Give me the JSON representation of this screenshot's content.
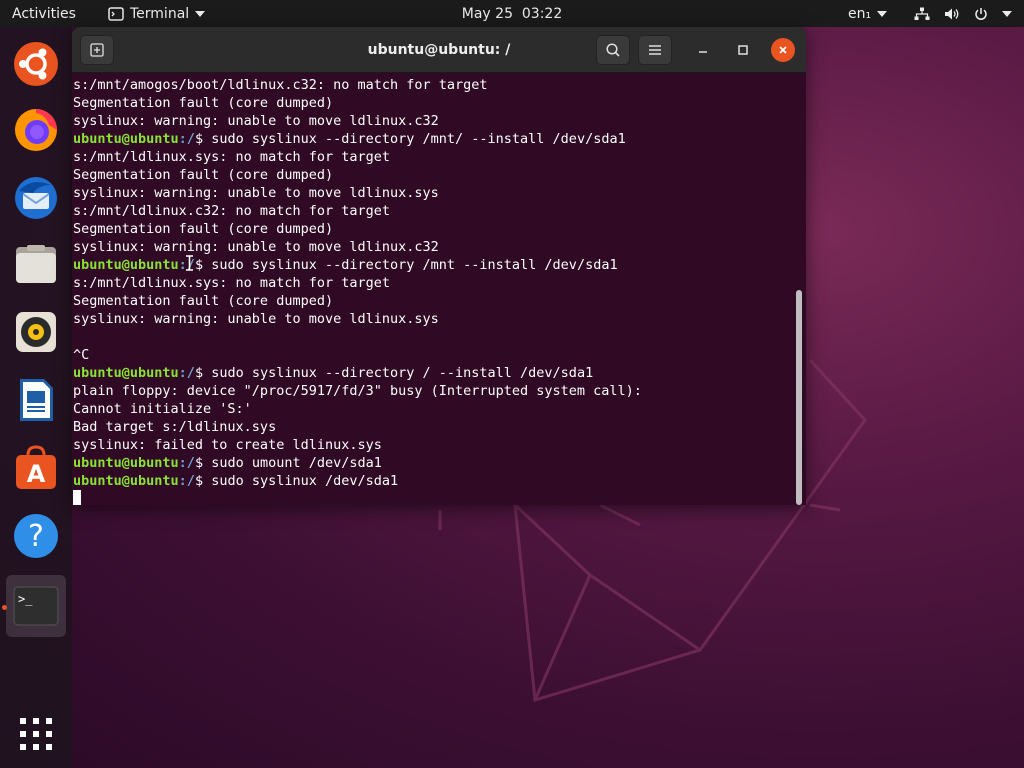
{
  "topbar": {
    "activities": "Activities",
    "app_name": "Terminal",
    "clock": "May 25  03:22",
    "language": "en₁"
  },
  "dock": {
    "items": [
      {
        "name": "Ubuntu installer",
        "icon": "ubuntu-installer-icon"
      },
      {
        "name": "Firefox",
        "icon": "firefox-icon"
      },
      {
        "name": "Thunderbird",
        "icon": "thunderbird-icon"
      },
      {
        "name": "Files",
        "icon": "files-icon"
      },
      {
        "name": "Rhythmbox",
        "icon": "rhythmbox-icon"
      },
      {
        "name": "LibreOffice Writer",
        "icon": "libreoffice-writer-icon"
      },
      {
        "name": "Ubuntu Software",
        "icon": "ubuntu-software-icon"
      },
      {
        "name": "Help",
        "icon": "help-icon"
      },
      {
        "name": "Terminal",
        "icon": "terminal-icon"
      },
      {
        "name": "Show Applications",
        "icon": "app-grid-icon"
      }
    ]
  },
  "window": {
    "title": "ubuntu@ubuntu: /"
  },
  "terminal": {
    "prompt_user": "ubuntu@ubuntu",
    "lines": [
      {
        "type": "out",
        "text": "s:/mnt/amogos/boot/ldlinux.c32: no match for target"
      },
      {
        "type": "out",
        "text": "Segmentation fault (core dumped)"
      },
      {
        "type": "out",
        "text": "syslinux: warning: unable to move ldlinux.c32"
      },
      {
        "type": "cmd",
        "user": "ubuntu@ubuntu",
        "path": ":/",
        "text": "$ sudo syslinux --directory /mnt/ --install /dev/sda1"
      },
      {
        "type": "out",
        "text": "s:/mnt/ldlinux.sys: no match for target"
      },
      {
        "type": "out",
        "text": "Segmentation fault (core dumped)"
      },
      {
        "type": "out",
        "text": "syslinux: warning: unable to move ldlinux.sys"
      },
      {
        "type": "out",
        "text": "s:/mnt/ldlinux.c32: no match for target"
      },
      {
        "type": "out",
        "text": "Segmentation fault (core dumped)"
      },
      {
        "type": "out",
        "text": "syslinux: warning: unable to move ldlinux.c32"
      },
      {
        "type": "cmd",
        "user": "ubuntu@ubuntu",
        "path": ":/",
        "text": "$ sudo syslinux --directory /mnt --install /dev/sda1"
      },
      {
        "type": "out",
        "text": "s:/mnt/ldlinux.sys: no match for target"
      },
      {
        "type": "out",
        "text": "Segmentation fault (core dumped)"
      },
      {
        "type": "out",
        "text": "syslinux: warning: unable to move ldlinux.sys"
      },
      {
        "type": "out",
        "text": ""
      },
      {
        "type": "out",
        "text": "^C"
      },
      {
        "type": "cmd",
        "user": "ubuntu@ubuntu",
        "path": ":/",
        "text": "$ sudo syslinux --directory / --install /dev/sda1"
      },
      {
        "type": "out",
        "text": "plain floppy: device \"/proc/5917/fd/3\" busy (Interrupted system call):"
      },
      {
        "type": "out",
        "text": "Cannot initialize 'S:'"
      },
      {
        "type": "out",
        "text": "Bad target s:/ldlinux.sys"
      },
      {
        "type": "out",
        "text": "syslinux: failed to create ldlinux.sys"
      },
      {
        "type": "cmd",
        "user": "ubuntu@ubuntu",
        "path": ":/",
        "text": "$ sudo umount /dev/sda1"
      },
      {
        "type": "cmd",
        "user": "ubuntu@ubuntu",
        "path": ":/",
        "text": "$ sudo syslinux /dev/sda1"
      }
    ]
  },
  "colors": {
    "terminal_bg": "#300a24",
    "prompt_user": "#8ae234",
    "prompt_path": "#729fcf",
    "accent": "#e95420"
  }
}
